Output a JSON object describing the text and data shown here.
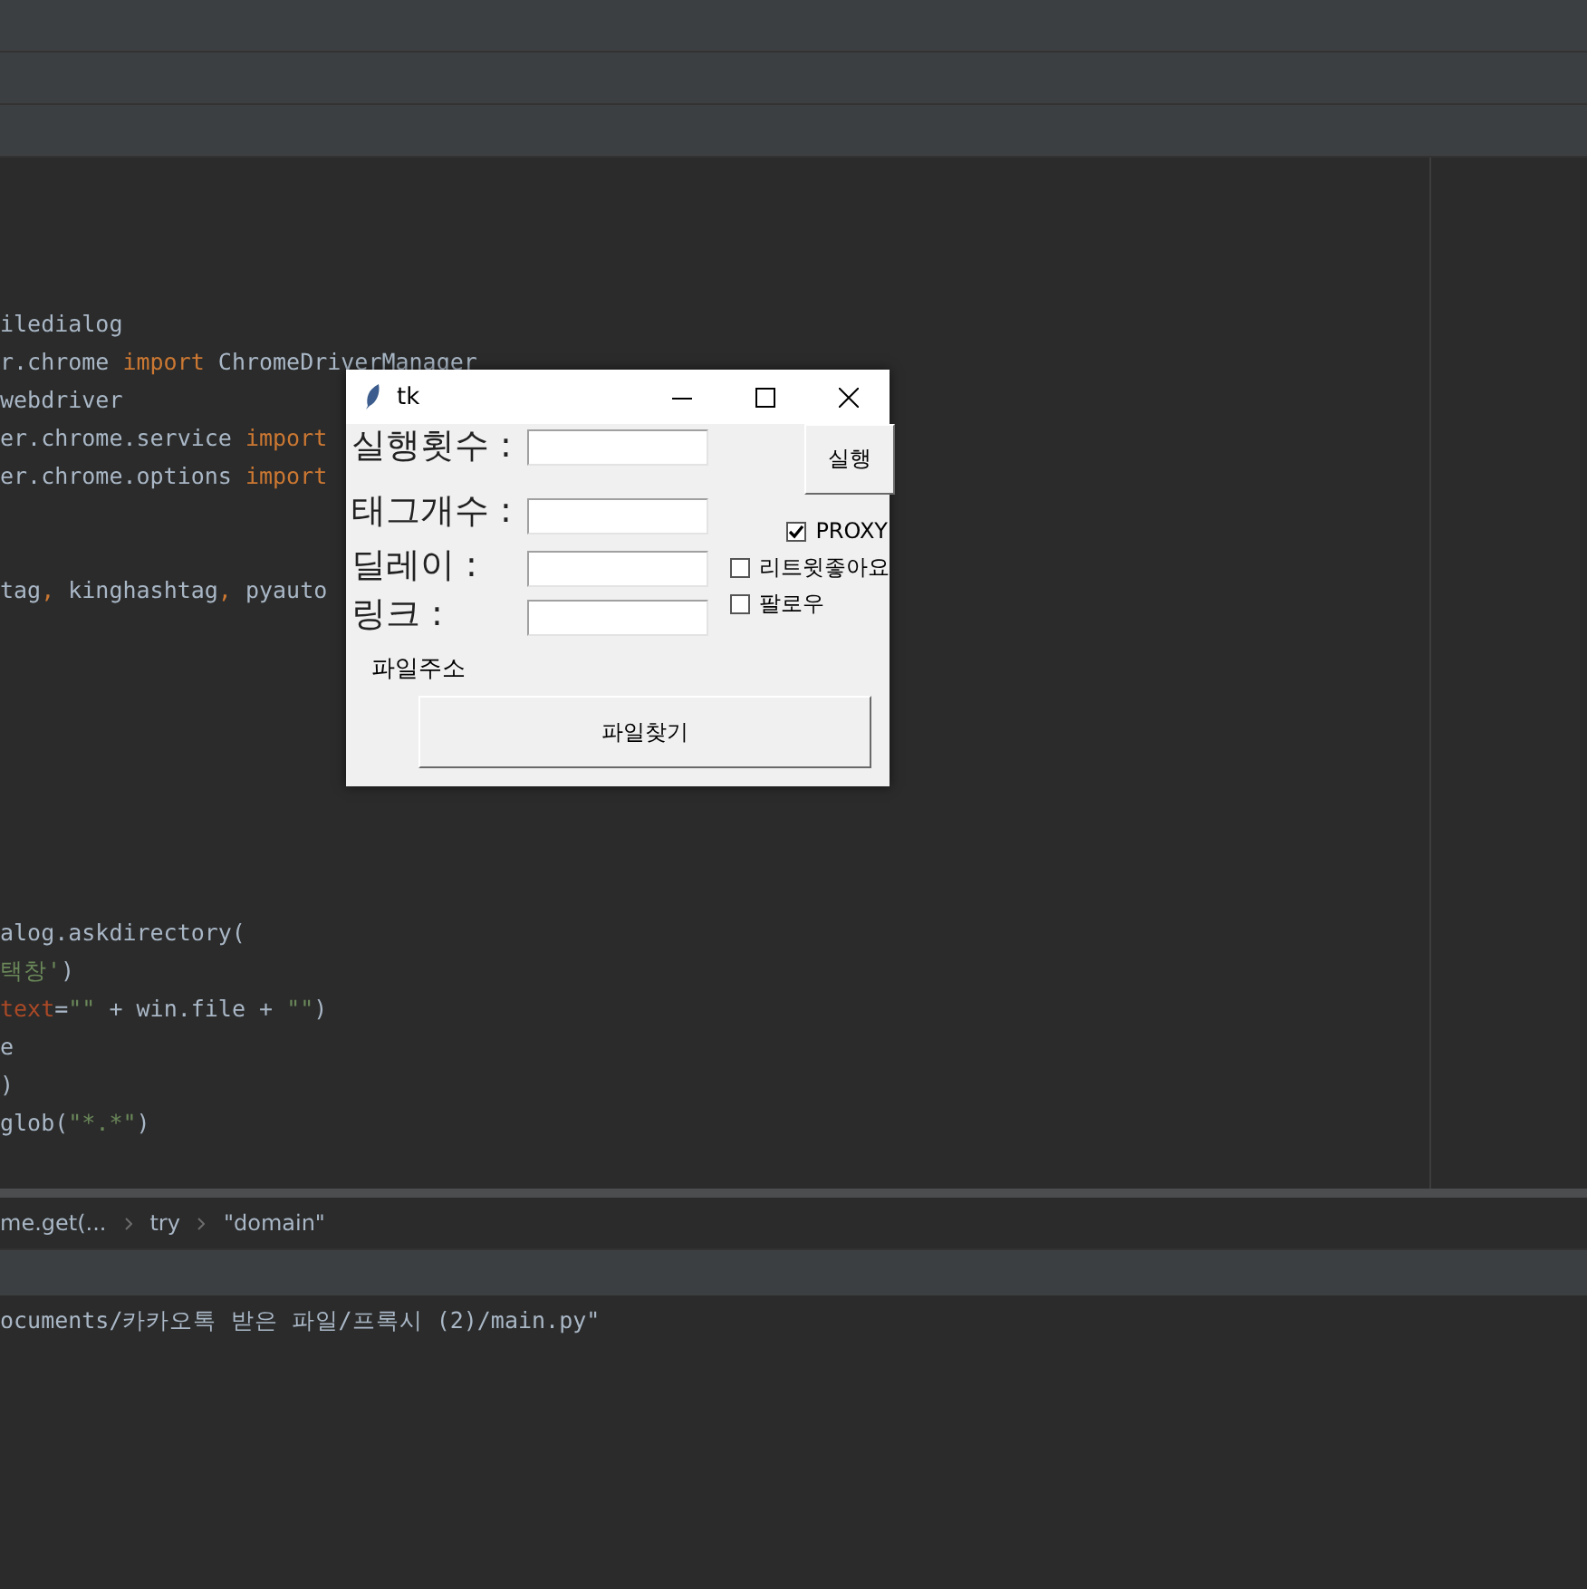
{
  "editor": {
    "lines": [
      {
        "kind": "code",
        "tokens": [
          {
            "text": "iledialog",
            "kind": "plain"
          }
        ]
      },
      {
        "kind": "code",
        "tokens": [
          {
            "text": "r.chrome ",
            "kind": "plain"
          },
          {
            "text": "import",
            "kind": "keyword"
          },
          {
            "text": " ChromeDriverManager",
            "kind": "plain"
          }
        ]
      },
      {
        "kind": "code",
        "tokens": [
          {
            "text": "webdriver",
            "kind": "plain"
          }
        ]
      },
      {
        "kind": "code",
        "tokens": [
          {
            "text": "er.chrome.service ",
            "kind": "plain"
          },
          {
            "text": "import",
            "kind": "keyword"
          }
        ]
      },
      {
        "kind": "code",
        "tokens": [
          {
            "text": "er.chrome.options ",
            "kind": "plain"
          },
          {
            "text": "import",
            "kind": "keyword"
          }
        ]
      },
      {
        "kind": "blank"
      },
      {
        "kind": "blank"
      },
      {
        "kind": "code",
        "tokens": [
          {
            "text": "tag",
            "kind": "plain"
          },
          {
            "text": ",",
            "kind": "keyword"
          },
          {
            "text": " kinghashtag",
            "kind": "plain"
          },
          {
            "text": ",",
            "kind": "keyword"
          },
          {
            "text": " pyauto",
            "kind": "plain"
          }
        ]
      },
      {
        "kind": "blank"
      },
      {
        "kind": "blank"
      },
      {
        "kind": "blank"
      },
      {
        "kind": "blank"
      },
      {
        "kind": "blank"
      },
      {
        "kind": "blank"
      },
      {
        "kind": "blank"
      },
      {
        "kind": "blank"
      },
      {
        "kind": "code",
        "tokens": [
          {
            "text": "alog.askdirectory(",
            "kind": "plain"
          }
        ]
      },
      {
        "kind": "code",
        "tokens": [
          {
            "text": "택창'",
            "kind": "string"
          },
          {
            "text": ")",
            "kind": "plain"
          }
        ]
      },
      {
        "kind": "code",
        "tokens": [
          {
            "text": "text",
            "kind": "param"
          },
          {
            "text": "=",
            "kind": "plain"
          },
          {
            "text": "\"\"",
            "kind": "string"
          },
          {
            "text": " + win.file + ",
            "kind": "plain"
          },
          {
            "text": "\"\"",
            "kind": "string"
          },
          {
            "text": ")",
            "kind": "plain"
          }
        ]
      },
      {
        "kind": "code",
        "tokens": [
          {
            "text": "e",
            "kind": "plain"
          }
        ]
      },
      {
        "kind": "code",
        "tokens": [
          {
            "text": ")",
            "kind": "plain"
          }
        ]
      },
      {
        "kind": "code",
        "tokens": [
          {
            "text": "glob(",
            "kind": "plain"
          },
          {
            "text": "\"*.*\"",
            "kind": "string"
          },
          {
            "text": ")",
            "kind": "plain"
          }
        ]
      }
    ]
  },
  "breadcrumbs": [
    "me.get(...",
    "try",
    "\"domain\""
  ],
  "terminal": {
    "lines": [
      "ocuments/카카오톡 받은 파일/프록시 (2)/main.py\""
    ]
  },
  "tk_window": {
    "title": "tk",
    "fields": [
      {
        "label": "실행횟수 :"
      },
      {
        "label": "태그개수 :"
      },
      {
        "label": "딜레이 :"
      },
      {
        "label": "링크 :"
      }
    ],
    "run_button": "실행",
    "checkboxes": [
      {
        "label": "PROXY",
        "checked": true
      },
      {
        "label": "리트윗좋아요",
        "checked": false
      },
      {
        "label": "팔로우",
        "checked": false
      }
    ],
    "file_label": "파일주소",
    "find_button": "파일찾기"
  }
}
